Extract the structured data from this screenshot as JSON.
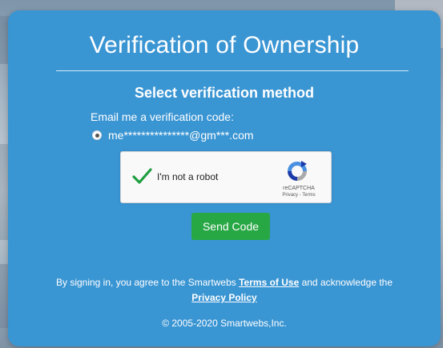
{
  "page": {
    "title": "Verification of Ownership",
    "subtitle": "Select verification method"
  },
  "method": {
    "label": "Email me a verification code:",
    "email": "me***************@gm***.com",
    "selected": true
  },
  "captcha": {
    "label": "I'm not a robot",
    "brand": "reCAPTCHA",
    "terms": "Privacy - Terms",
    "checked": true
  },
  "actions": {
    "send_label": "Send Code"
  },
  "legal": {
    "prefix": "By signing in, you agree to the Smartwebs ",
    "terms_link": "Terms of Use",
    "middle": " and acknowledge the",
    "privacy_link": "Privacy Policy"
  },
  "footer": {
    "copyright": "© 2005-2020 Smartwebs,Inc."
  },
  "colors": {
    "card": "#3a95d3",
    "button": "#28a745",
    "check": "#1e9e3e"
  },
  "icons": {
    "checkmark": "check-icon",
    "recaptcha": "recaptcha-logo-icon",
    "radio": "radio-selected-icon"
  }
}
